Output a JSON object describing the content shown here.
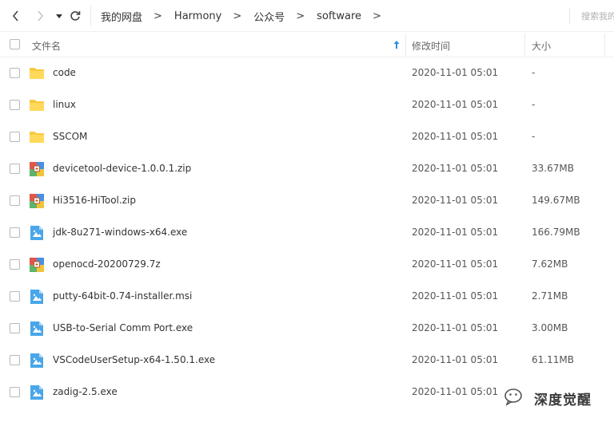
{
  "nav": {
    "back_icon": "chevron-left-icon",
    "forward_icon": "chevron-right-icon",
    "dropdown_icon": "caret-down-icon",
    "refresh_icon": "refresh-icon"
  },
  "breadcrumb": {
    "items": [
      "我的网盘",
      "Harmony",
      "公众号",
      "software"
    ],
    "separator": ">"
  },
  "search": {
    "placeholder": "搜索我的"
  },
  "columns": {
    "name": "文件名",
    "modified": "修改时间",
    "size": "大小",
    "sort_icon": "sort-ascending-icon"
  },
  "files": [
    {
      "name": "code",
      "time": "2020-11-01 05:01",
      "size": "-",
      "icon": "folder-icon"
    },
    {
      "name": "linux",
      "time": "2020-11-01 05:01",
      "size": "-",
      "icon": "folder-icon"
    },
    {
      "name": "SSCOM",
      "time": "2020-11-01 05:01",
      "size": "-",
      "icon": "folder-icon"
    },
    {
      "name": "devicetool-device-1.0.0.1.zip",
      "time": "2020-11-01 05:01",
      "size": "33.67MB",
      "icon": "archive-icon"
    },
    {
      "name": "Hi3516-HiTool.zip",
      "time": "2020-11-01 05:01",
      "size": "149.67MB",
      "icon": "archive-icon"
    },
    {
      "name": "jdk-8u271-windows-x64.exe",
      "time": "2020-11-01 05:01",
      "size": "166.79MB",
      "icon": "exe-icon"
    },
    {
      "name": "openocd-20200729.7z",
      "time": "2020-11-01 05:01",
      "size": "7.62MB",
      "icon": "archive-icon"
    },
    {
      "name": "putty-64bit-0.74-installer.msi",
      "time": "2020-11-01 05:01",
      "size": "2.71MB",
      "icon": "exe-icon"
    },
    {
      "name": "USB-to-Serial Comm Port.exe",
      "time": "2020-11-01 05:01",
      "size": "3.00MB",
      "icon": "exe-icon"
    },
    {
      "name": "VSCodeUserSetup-x64-1.50.1.exe",
      "time": "2020-11-01 05:01",
      "size": "61.11MB",
      "icon": "exe-icon"
    },
    {
      "name": "zadig-2.5.exe",
      "time": "2020-11-01 05:01",
      "size": "",
      "icon": "exe-icon"
    }
  ],
  "watermark": {
    "text": "深度觉醒",
    "icon": "wechat-icon"
  },
  "colors": {
    "folder": "#f7c842",
    "exe": "#4aa6e8",
    "archive_red": "#e0574a",
    "archive_blue": "#4a8fe0",
    "archive_green": "#5bb56a",
    "archive_yellow": "#f2c33a",
    "sort_arrow": "#2a8ee0"
  }
}
